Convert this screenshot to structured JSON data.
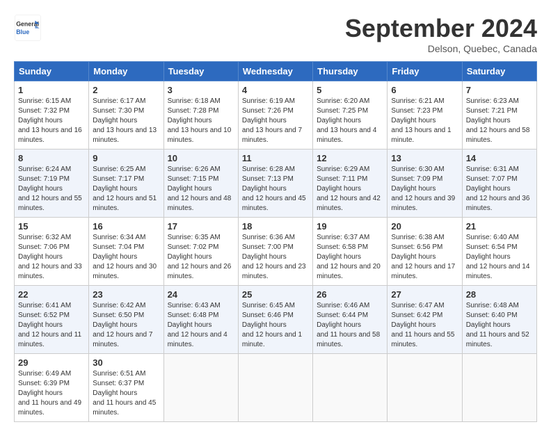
{
  "header": {
    "logo_line1": "General",
    "logo_line2": "Blue",
    "month": "September 2024",
    "location": "Delson, Quebec, Canada"
  },
  "days_of_week": [
    "Sunday",
    "Monday",
    "Tuesday",
    "Wednesday",
    "Thursday",
    "Friday",
    "Saturday"
  ],
  "weeks": [
    [
      {
        "day": "1",
        "sunrise": "6:15 AM",
        "sunset": "7:32 PM",
        "daylight": "13 hours and 16 minutes."
      },
      {
        "day": "2",
        "sunrise": "6:17 AM",
        "sunset": "7:30 PM",
        "daylight": "13 hours and 13 minutes."
      },
      {
        "day": "3",
        "sunrise": "6:18 AM",
        "sunset": "7:28 PM",
        "daylight": "13 hours and 10 minutes."
      },
      {
        "day": "4",
        "sunrise": "6:19 AM",
        "sunset": "7:26 PM",
        "daylight": "13 hours and 7 minutes."
      },
      {
        "day": "5",
        "sunrise": "6:20 AM",
        "sunset": "7:25 PM",
        "daylight": "13 hours and 4 minutes."
      },
      {
        "day": "6",
        "sunrise": "6:21 AM",
        "sunset": "7:23 PM",
        "daylight": "13 hours and 1 minute."
      },
      {
        "day": "7",
        "sunrise": "6:23 AM",
        "sunset": "7:21 PM",
        "daylight": "12 hours and 58 minutes."
      }
    ],
    [
      {
        "day": "8",
        "sunrise": "6:24 AM",
        "sunset": "7:19 PM",
        "daylight": "12 hours and 55 minutes."
      },
      {
        "day": "9",
        "sunrise": "6:25 AM",
        "sunset": "7:17 PM",
        "daylight": "12 hours and 51 minutes."
      },
      {
        "day": "10",
        "sunrise": "6:26 AM",
        "sunset": "7:15 PM",
        "daylight": "12 hours and 48 minutes."
      },
      {
        "day": "11",
        "sunrise": "6:28 AM",
        "sunset": "7:13 PM",
        "daylight": "12 hours and 45 minutes."
      },
      {
        "day": "12",
        "sunrise": "6:29 AM",
        "sunset": "7:11 PM",
        "daylight": "12 hours and 42 minutes."
      },
      {
        "day": "13",
        "sunrise": "6:30 AM",
        "sunset": "7:09 PM",
        "daylight": "12 hours and 39 minutes."
      },
      {
        "day": "14",
        "sunrise": "6:31 AM",
        "sunset": "7:07 PM",
        "daylight": "12 hours and 36 minutes."
      }
    ],
    [
      {
        "day": "15",
        "sunrise": "6:32 AM",
        "sunset": "7:06 PM",
        "daylight": "12 hours and 33 minutes."
      },
      {
        "day": "16",
        "sunrise": "6:34 AM",
        "sunset": "7:04 PM",
        "daylight": "12 hours and 30 minutes."
      },
      {
        "day": "17",
        "sunrise": "6:35 AM",
        "sunset": "7:02 PM",
        "daylight": "12 hours and 26 minutes."
      },
      {
        "day": "18",
        "sunrise": "6:36 AM",
        "sunset": "7:00 PM",
        "daylight": "12 hours and 23 minutes."
      },
      {
        "day": "19",
        "sunrise": "6:37 AM",
        "sunset": "6:58 PM",
        "daylight": "12 hours and 20 minutes."
      },
      {
        "day": "20",
        "sunrise": "6:38 AM",
        "sunset": "6:56 PM",
        "daylight": "12 hours and 17 minutes."
      },
      {
        "day": "21",
        "sunrise": "6:40 AM",
        "sunset": "6:54 PM",
        "daylight": "12 hours and 14 minutes."
      }
    ],
    [
      {
        "day": "22",
        "sunrise": "6:41 AM",
        "sunset": "6:52 PM",
        "daylight": "12 hours and 11 minutes."
      },
      {
        "day": "23",
        "sunrise": "6:42 AM",
        "sunset": "6:50 PM",
        "daylight": "12 hours and 7 minutes."
      },
      {
        "day": "24",
        "sunrise": "6:43 AM",
        "sunset": "6:48 PM",
        "daylight": "12 hours and 4 minutes."
      },
      {
        "day": "25",
        "sunrise": "6:45 AM",
        "sunset": "6:46 PM",
        "daylight": "12 hours and 1 minute."
      },
      {
        "day": "26",
        "sunrise": "6:46 AM",
        "sunset": "6:44 PM",
        "daylight": "11 hours and 58 minutes."
      },
      {
        "day": "27",
        "sunrise": "6:47 AM",
        "sunset": "6:42 PM",
        "daylight": "11 hours and 55 minutes."
      },
      {
        "day": "28",
        "sunrise": "6:48 AM",
        "sunset": "6:40 PM",
        "daylight": "11 hours and 52 minutes."
      }
    ],
    [
      {
        "day": "29",
        "sunrise": "6:49 AM",
        "sunset": "6:39 PM",
        "daylight": "11 hours and 49 minutes."
      },
      {
        "day": "30",
        "sunrise": "6:51 AM",
        "sunset": "6:37 PM",
        "daylight": "11 hours and 45 minutes."
      },
      null,
      null,
      null,
      null,
      null
    ]
  ]
}
